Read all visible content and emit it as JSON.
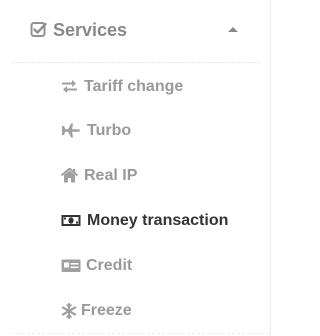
{
  "section": {
    "icon": "checkbox-checked-icon",
    "title": "Services",
    "expanded": true,
    "caret_icon": "caret-up-icon"
  },
  "menu": {
    "items": [
      {
        "label": "Tariff change",
        "icon": "exchange-arrows-icon",
        "active": false
      },
      {
        "label": "Turbo",
        "icon": "plane-icon",
        "active": false
      },
      {
        "label": "Real IP",
        "icon": "home-icon",
        "active": false
      },
      {
        "label": "Money transaction",
        "icon": "money-bill-icon",
        "active": true
      },
      {
        "label": "Credit",
        "icon": "credit-card-icon",
        "active": false
      },
      {
        "label": "Freeze",
        "icon": "snowflake-icon",
        "active": false
      }
    ]
  },
  "colors": {
    "header_text": "#888888",
    "item_text": "#999999",
    "active_text": "#333333",
    "icon_color": "#a0a0a0"
  }
}
